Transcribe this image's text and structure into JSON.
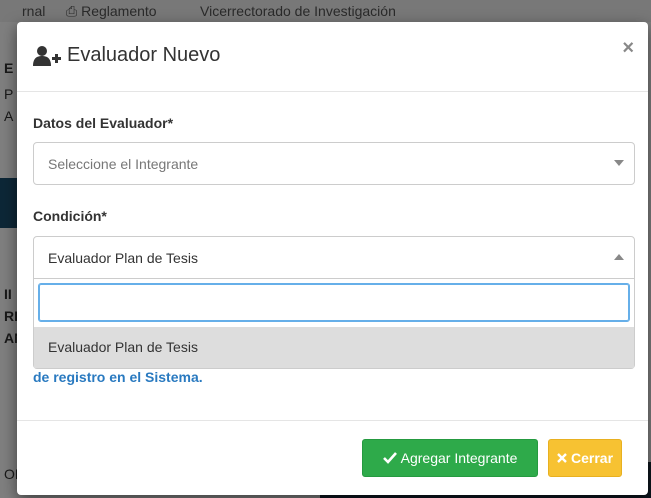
{
  "background": {
    "topbar_fragments": [
      "rnal",
      "Reglamento",
      "Vicerrectorado de Investigación"
    ],
    "side_letters": [
      "E",
      "P",
      "A",
      "II",
      "RI",
      "AN"
    ],
    "bottom_left_letters": "OF"
  },
  "modal": {
    "title": "Evaluador Nuevo",
    "title_icon": "user-plus-icon",
    "close_symbol": "×"
  },
  "fields": {
    "evaluador": {
      "label": "Datos del Evaluador*",
      "placeholder": "Seleccione el Integrante"
    },
    "condicion": {
      "label": "Condición*",
      "selected": "Evaluador Plan de Tesis",
      "search_value": "",
      "options": [
        "Evaluador Plan de Tesis"
      ]
    }
  },
  "notice": {
    "link_text": "de registro en el Sistema."
  },
  "footer": {
    "add_label": "Agregar Integrante",
    "close_label": "Cerrar"
  },
  "colors": {
    "success": "#2eaa4a",
    "warning": "#f7c232",
    "link": "#2a7ac0"
  }
}
